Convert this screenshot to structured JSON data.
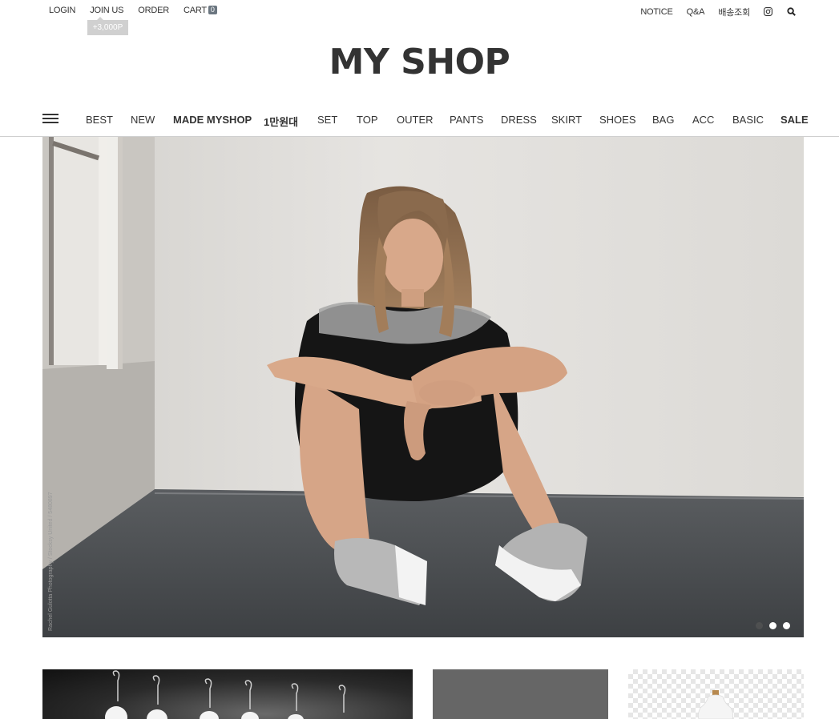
{
  "topbar": {
    "left": [
      {
        "label": "LOGIN"
      },
      {
        "label": "JOIN US"
      },
      {
        "label": "ORDER"
      },
      {
        "label": "CART"
      }
    ],
    "cart_count": "0",
    "join_tooltip": "+3,000P",
    "right": [
      {
        "label": "NOTICE"
      },
      {
        "label": "Q&A"
      },
      {
        "label": "배송조회"
      }
    ],
    "icons": [
      "instagram-icon",
      "search-icon"
    ]
  },
  "logo": "MY SHOP",
  "nav": {
    "items": [
      {
        "label": "BEST",
        "bold": false
      },
      {
        "label": "NEW",
        "bold": false
      },
      {
        "label": "MADE MYSHOP",
        "bold": true
      },
      {
        "label": "1만원대",
        "bold": true
      },
      {
        "label": "SET",
        "bold": false
      },
      {
        "label": "TOP",
        "bold": false
      },
      {
        "label": "OUTER",
        "bold": false
      },
      {
        "label": "PANTS",
        "bold": false
      },
      {
        "label": "DRESS",
        "bold": false
      },
      {
        "label": "SKIRT",
        "bold": false
      },
      {
        "label": "SHOES",
        "bold": false
      },
      {
        "label": "BAG",
        "bold": false
      },
      {
        "label": "ACC",
        "bold": false
      },
      {
        "label": "BASIC",
        "bold": false
      },
      {
        "label": "SALE",
        "bold": true
      }
    ]
  },
  "hero": {
    "credit": "Rachel Gulotta Photography / Stocksy United / 5480897",
    "slides": 3,
    "active_slide": 1
  }
}
